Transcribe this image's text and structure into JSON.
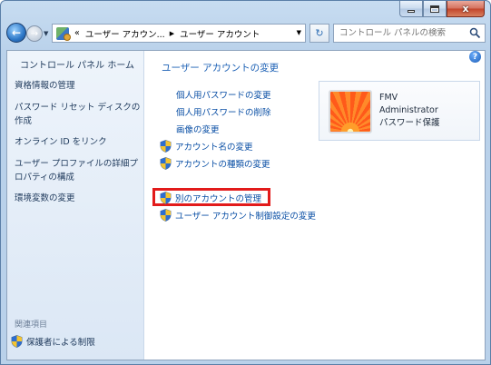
{
  "window": {
    "caption_min": "",
    "caption_max": "",
    "caption_close": "x"
  },
  "nav": {
    "back_icon": "back-arrow-icon",
    "forward_icon": "forward-arrow-icon",
    "breadcrumb_root": "«",
    "breadcrumb_1": "ユーザー アカウン...",
    "breadcrumb_2": "ユーザー アカウント",
    "search_placeholder": "コントロール パネルの検索"
  },
  "sidebar": {
    "home": "コントロール パネル ホーム",
    "items": [
      {
        "label": "資格情報の管理"
      },
      {
        "label": "パスワード リセット ディスクの作成"
      },
      {
        "label": "オンライン ID をリンク"
      },
      {
        "label": "ユーザー プロファイルの詳細プロパティの構成"
      },
      {
        "label": "環境変数の変更"
      }
    ],
    "related_title": "関連項目",
    "related_item": "保護者による制限"
  },
  "main": {
    "title": "ユーザー アカウントの変更",
    "tasks": [
      {
        "label": "個人用パスワードの変更",
        "shield": false
      },
      {
        "label": "個人用パスワードの削除",
        "shield": false
      },
      {
        "label": "画像の変更",
        "shield": false
      },
      {
        "label": "アカウント名の変更",
        "shield": true
      },
      {
        "label": "アカウントの種類の変更",
        "shield": true
      }
    ],
    "tasks2": [
      {
        "label": "別のアカウントの管理",
        "shield": true,
        "highlighted": true
      },
      {
        "label": "ユーザー アカウント制御設定の変更",
        "shield": true
      }
    ]
  },
  "account": {
    "name": "FMV",
    "type": "Administrator",
    "status": "パスワード保護"
  },
  "colors": {
    "accent": "#0a4fa5",
    "highlight": "#e21b1b"
  }
}
